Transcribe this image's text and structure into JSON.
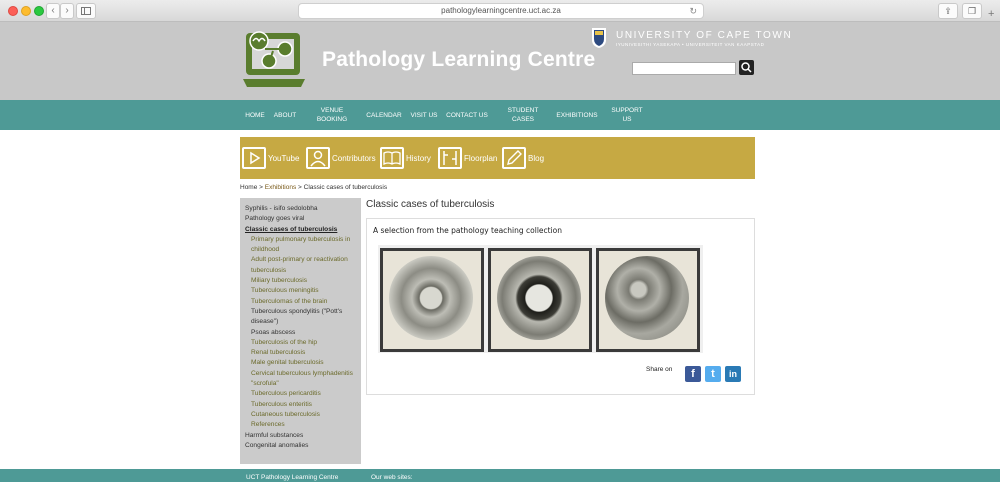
{
  "browser": {
    "url": "pathologylearningcentre.uct.ac.za"
  },
  "header": {
    "site_title": "Pathology Learning Centre",
    "university_name": "UNIVERSITY OF CAPE TOWN",
    "university_sub": "IYUNIVESITHI YASEKAPA • UNIVERSITEIT VAN KAAPSTAD",
    "search_placeholder": ""
  },
  "nav": {
    "items": [
      {
        "label": "HOME"
      },
      {
        "label": "ABOUT"
      },
      {
        "label": "VENUE BOOKING"
      },
      {
        "label": "CALENDAR"
      },
      {
        "label": "VISIT US"
      },
      {
        "label": "CONTACT US"
      },
      {
        "label": "STUDENT CASES"
      },
      {
        "label": "EXHIBITIONS"
      },
      {
        "label": "SUPPORT US"
      }
    ]
  },
  "toolbar": {
    "items": [
      {
        "label": "YouTube",
        "icon": "play-icon"
      },
      {
        "label": "Contributors",
        "icon": "person-icon"
      },
      {
        "label": "History",
        "icon": "book-icon"
      },
      {
        "label": "Floorplan",
        "icon": "floorplan-icon"
      },
      {
        "label": "Blog",
        "icon": "pencil-icon"
      }
    ]
  },
  "breadcrumb": {
    "home": "Home",
    "sep1": " > ",
    "exhibitions": "Exhibitions",
    "sep2": " > ",
    "current": "Classic cases of tuberculosis"
  },
  "sidebar": {
    "items": [
      {
        "label": "Syphilis - isifo sedolobha"
      },
      {
        "label": "Pathology goes viral"
      },
      {
        "label": "Classic cases of tuberculosis"
      },
      {
        "label": "Primary pulmonary tuberculosis in childhood"
      },
      {
        "label": "Adult post-primary or reactivation tuberculosis"
      },
      {
        "label": "Miliary tuberculosis"
      },
      {
        "label": "Tuberculous meningitis"
      },
      {
        "label": "Tuberculomas of the brain"
      },
      {
        "label": "Tuberculous spondylitis (\"Pott's disease\")"
      },
      {
        "label": "Psoas abscess"
      },
      {
        "label": "Tuberculosis of the hip"
      },
      {
        "label": "Renal tuberculosis"
      },
      {
        "label": "Male genital tuberculosis"
      },
      {
        "label": "Cervical tuberculous lymphadenitis \"scrofula\""
      },
      {
        "label": "Tuberculous pericarditis"
      },
      {
        "label": "Tuberculous enteritis"
      },
      {
        "label": "Cutaneous tuberculosis"
      },
      {
        "label": "References"
      },
      {
        "label": "Harmful substances"
      },
      {
        "label": "Congenital anomalies"
      }
    ]
  },
  "main": {
    "title": "Classic cases of tuberculosis",
    "subtitle": "A selection from the pathology teaching collection",
    "share_label": "Share on",
    "social": {
      "facebook": "f",
      "twitter": "t",
      "linkedin": "in"
    }
  },
  "footer": {
    "left": "UCT Pathology Learning Centre",
    "right": "Our web sites:"
  },
  "colors": {
    "header_bg": "#c8c8c8",
    "nav_bg": "#4e9a96",
    "toolbar_bg": "#c6a943",
    "sidebar_bg": "#cbcbcb",
    "logo_green": "#5a7d2e"
  }
}
